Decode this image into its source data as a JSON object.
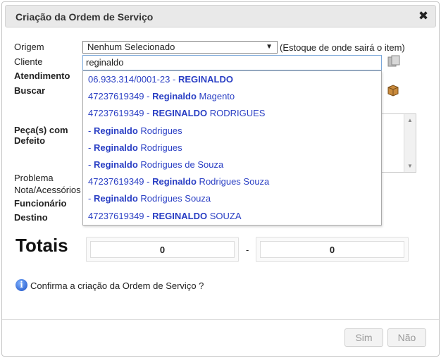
{
  "dialog": {
    "title": "Criação da Ordem de Serviço",
    "close_glyph": "✖"
  },
  "form": {
    "origem_label": "Origem",
    "origem_value": "Nenhum Selecionado",
    "origem_hint": "(Estoque de onde sairá o item)",
    "cliente_label": "Cliente",
    "cliente_value": "reginaldo",
    "atendimento_label": "Atendimento",
    "buscar_label": "Buscar",
    "peca_label_1": "Peça(s) com",
    "peca_label_2": "Defeito",
    "problema_label": "Problema",
    "nota_label": "Nota/Acessórios",
    "funcionario_label": "Funcionário",
    "destino_label": "Destino"
  },
  "suggestions": [
    {
      "prefix": "06.933.314/0001-23 - ",
      "match": "REGINALDO",
      "rest": ""
    },
    {
      "prefix": "47237619349 - ",
      "match": "Reginaldo",
      "rest": " Magento"
    },
    {
      "prefix": "47237619349 - ",
      "match": "REGINALDO",
      "rest": " RODRIGUES"
    },
    {
      "prefix": " - ",
      "match": "Reginaldo",
      "rest": " Rodrigues"
    },
    {
      "prefix": " - ",
      "match": "Reginaldo",
      "rest": " Rodrigues"
    },
    {
      "prefix": " - ",
      "match": "Reginaldo",
      "rest": " Rodrigues de Souza"
    },
    {
      "prefix": "47237619349 - ",
      "match": "Reginaldo",
      "rest": " Rodrigues Souza"
    },
    {
      "prefix": " - ",
      "match": "Reginaldo",
      "rest": " Rodrigues Souza"
    },
    {
      "prefix": "47237619349 - ",
      "match": "REGINALDO",
      "rest": " SOUZA"
    }
  ],
  "totais": {
    "label": "Totais",
    "value_1": "0",
    "separator": "-",
    "value_2": "0"
  },
  "confirm": {
    "icon": "info-icon",
    "text": "Confirma a criação da Ordem de Serviço ?"
  },
  "buttons": {
    "sim": "Sim",
    "nao": "Não"
  },
  "colors": {
    "link": "#2a3fc4",
    "titlebar": "#e9e9e9"
  }
}
